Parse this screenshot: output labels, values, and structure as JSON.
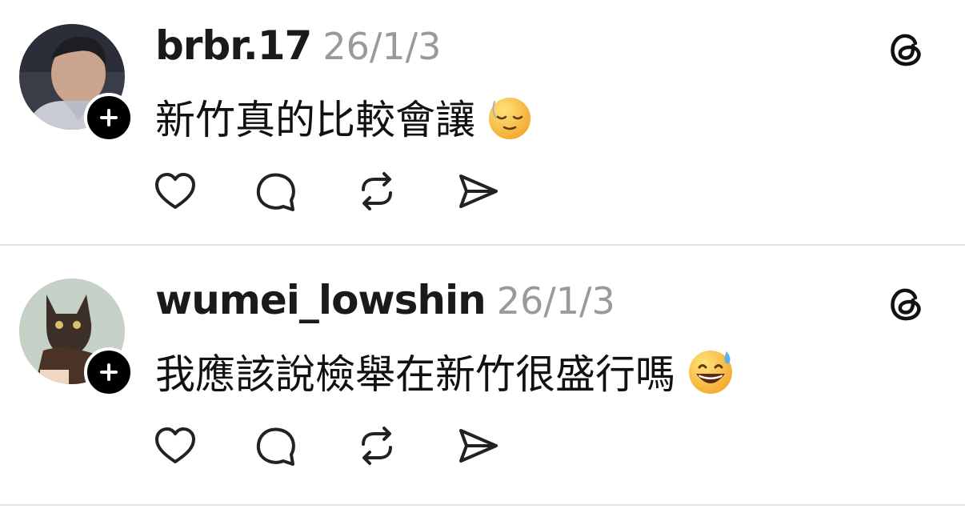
{
  "posts": [
    {
      "username": "brbr.17",
      "date": "26/1/3",
      "text": "新竹真的比較會讓",
      "emoji": "face-with-tear-smirk"
    },
    {
      "username": "wumei_lowshin",
      "date": "26/1/3",
      "text": "我應該說檢舉在新竹很盛行嗎",
      "emoji": "grinning-sweat-face"
    }
  ],
  "icons": {
    "like": "heart-icon",
    "reply": "comment-bubble-icon",
    "repost": "repost-icon",
    "share": "send-icon",
    "app": "threads-logo-icon",
    "follow": "plus-icon"
  },
  "colors": {
    "text": "#1a1a1a",
    "muted": "#9a9a9a",
    "divider": "#e4e4e4",
    "badge": "#000000"
  }
}
